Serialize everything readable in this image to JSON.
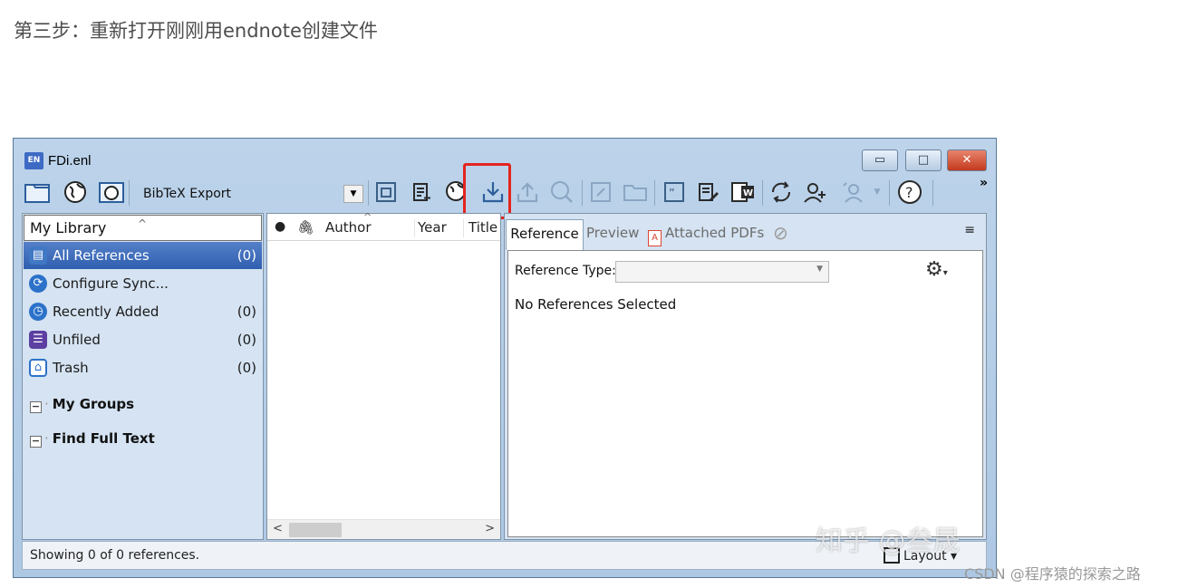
{
  "caption": "第三步：重新打开刚刚用endnote创建文件",
  "window": {
    "icon_text": "EN",
    "title": "FDi.enl",
    "controls": {
      "minimize": "▭",
      "maximize": "□",
      "close": "✕"
    }
  },
  "toolbar": {
    "style_value": "BibTeX Export",
    "more_label": "»",
    "icons": [
      "folder-icon",
      "online-icon",
      "integrated-icon",
      "copy-to-library-icon",
      "new-reference-icon",
      "online-search-icon",
      "import-icon",
      "export-icon",
      "find-pdf-icon",
      "open-link-icon",
      "open-file-icon",
      "insert-citation-icon",
      "format-bibliography-icon",
      "word-icon",
      "sync-icon",
      "share-icon",
      "group-icon",
      "help-icon"
    ]
  },
  "library": {
    "selector": "My Library",
    "items": [
      {
        "label": "All References",
        "count": "(0)",
        "icon": "all-references-icon",
        "color": "#4178c4"
      },
      {
        "label": "Configure Sync...",
        "count": "",
        "icon": "sync-icon",
        "color": "#2c72c9"
      },
      {
        "label": "Recently Added",
        "count": "(0)",
        "icon": "clock-icon",
        "color": "#2c72c9"
      },
      {
        "label": "Unfiled",
        "count": "(0)",
        "icon": "unfiled-icon",
        "color": "#5c3fa1"
      },
      {
        "label": "Trash",
        "count": "(0)",
        "icon": "trash-icon",
        "color": "#2c72c9"
      }
    ],
    "groups": [
      {
        "label": "My Groups"
      },
      {
        "label": "Find Full Text"
      }
    ]
  },
  "columns": {
    "author": "Author",
    "year": "Year",
    "title": "Title"
  },
  "reference_panel": {
    "tabs": {
      "reference": "Reference",
      "preview": "Preview",
      "pdfs": "Attached PDFs"
    },
    "ref_type_label": "Reference Type:",
    "empty_message": "No References Selected"
  },
  "status": {
    "text": "Showing 0 of 0 references.",
    "layout": "Layout"
  },
  "watermark": {
    "zhihu": "知乎 @叁晟",
    "csdn": "CSDN @程序猿的探索之路"
  }
}
